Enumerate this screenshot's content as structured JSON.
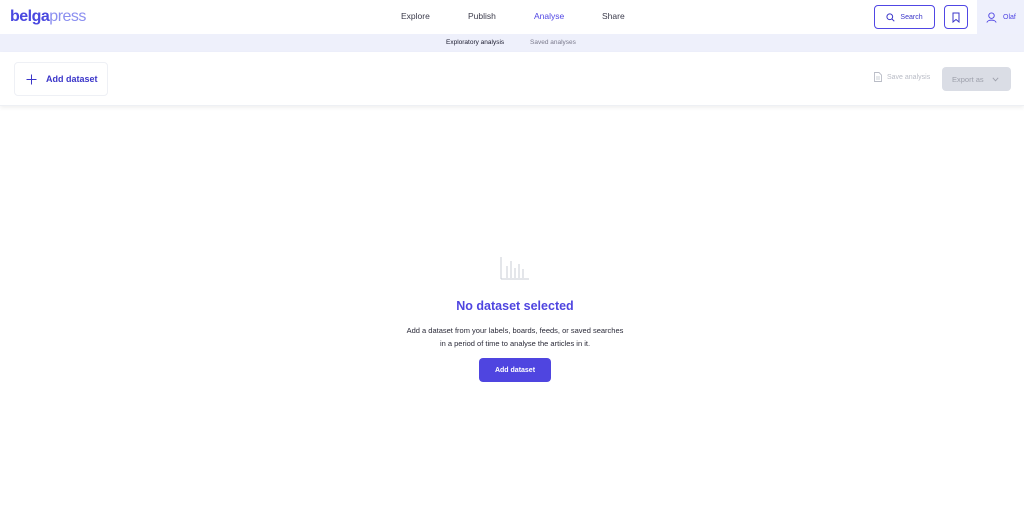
{
  "brand": {
    "part1": "belga",
    "part2": "press"
  },
  "nav": {
    "items": [
      {
        "label": "Explore",
        "active": false
      },
      {
        "label": "Publish",
        "active": false
      },
      {
        "label": "Analyse",
        "active": true
      },
      {
        "label": "Share",
        "active": false
      }
    ],
    "search_label": "Search",
    "user_name": "Olaf"
  },
  "subnav": {
    "items": [
      {
        "label": "Exploratory analysis",
        "active": true
      },
      {
        "label": "Saved analyses",
        "active": false
      }
    ]
  },
  "toolbar": {
    "add_dataset_label": "Add dataset",
    "save_analysis_label": "Save analysis",
    "export_label": "Export as"
  },
  "empty_state": {
    "title": "No dataset selected",
    "description_line1": "Add a dataset from your labels, boards, feeds, or saved searches",
    "description_line2": "in a period of time to analyse the articles in it.",
    "button_label": "Add dataset"
  },
  "colors": {
    "accent": "#4f45e0",
    "subnav_bg": "#eef0fb",
    "disabled_bg": "#dadde5"
  },
  "icons": {
    "search": "search-icon",
    "bookmark": "bookmark-icon",
    "user": "user-icon",
    "plus": "plus-icon",
    "document": "document-icon",
    "chevron": "chevron-down-icon",
    "chart": "bar-chart-icon"
  }
}
